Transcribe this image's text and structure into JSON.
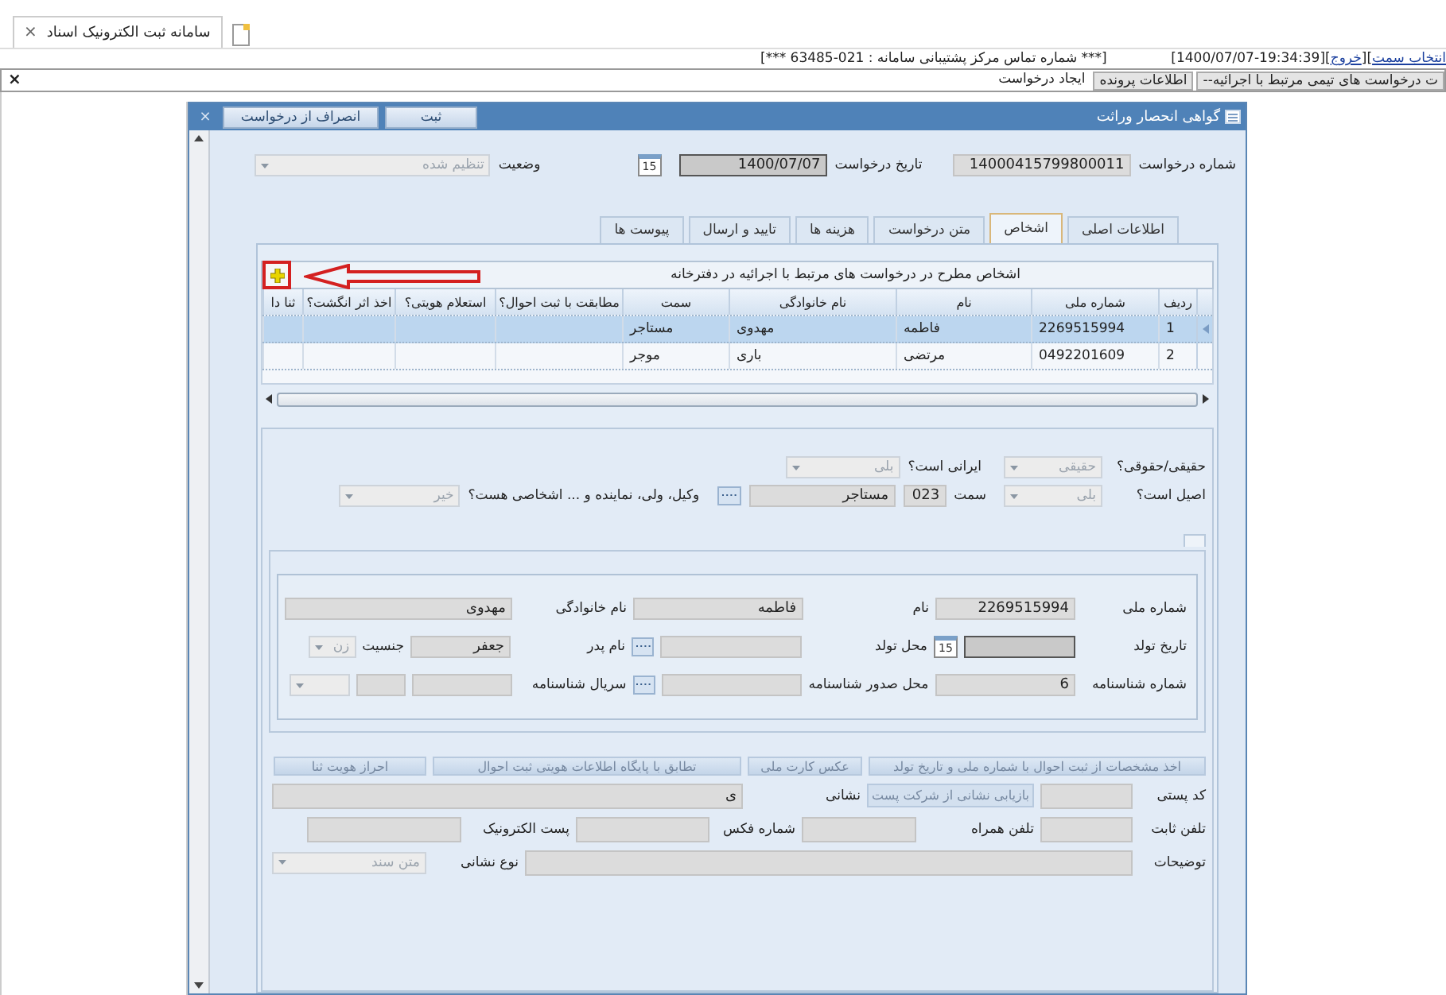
{
  "browser_tab": {
    "title": "سامانه ثبت الکترونیک اسناد",
    "close": "×"
  },
  "session_line": {
    "support": "[*** شماره تماس مرکز پشتیبانی سامانه : 021-63485 ***]",
    "parts": [
      {
        "kind": "link",
        "text": "انتخاب سمت"
      },
      {
        "kind": "text",
        "text": "]["
      },
      {
        "kind": "link",
        "text": "خروج"
      },
      {
        "kind": "text",
        "text": "[1400/07/07-19:34:39]["
      }
    ]
  },
  "menu_bar": {
    "close": "×",
    "items": [
      {
        "label": "ت درخواست های تیمی مرتبط با اجرائیه--",
        "selected": false
      },
      {
        "label": "اطلاعات پرونده",
        "selected": false
      },
      {
        "label": "ایجاد درخواست",
        "selected": true
      }
    ]
  },
  "dialog": {
    "title": "گواهی انحصار وراثت",
    "close": "×",
    "buttons": [
      "ثبت",
      "انصراف از درخواست"
    ],
    "request_number": {
      "label": "شماره درخواست",
      "value": "14000415799800011"
    },
    "request_date": {
      "label": "تاریخ درخواست",
      "value": "1400/07/07",
      "calendar": "15"
    },
    "status": {
      "label": "وضعیت",
      "value": "تنظیم شده"
    },
    "tabs": [
      {
        "label": "اطلاعات اصلی",
        "selected": false
      },
      {
        "label": "اشخاص",
        "selected": true
      },
      {
        "label": "متن درخواست",
        "selected": false
      },
      {
        "label": "هزینه ها",
        "selected": false
      },
      {
        "label": "تایید و ارسال",
        "selected": false
      },
      {
        "label": "پیوست ها",
        "selected": false
      }
    ],
    "persons": {
      "caption": "اشخاص مطرح در درخواست های مرتبط با اجرائیه در دفترخانه",
      "columns": [
        "ردیف",
        "شماره ملی",
        "نام",
        "نام خانوادگی",
        "سمت",
        "مطابقت با ثبت احوال؟",
        "استعلام هویتی؟",
        "اخذ اثر انگشت؟",
        "ثنا دا"
      ],
      "rows": [
        {
          "row": "1",
          "national_id": "2269515994",
          "first_name": "فاطمه",
          "last_name": "مهدوی",
          "role": "مستاجر",
          "selected": true
        },
        {
          "row": "2",
          "national_id": "0492201609",
          "first_name": "مرتضی",
          "last_name": "باری",
          "role": "موجر",
          "selected": false
        }
      ]
    },
    "person_form": {
      "top_rows": [
        [
          {
            "kind": "select",
            "label": "حقیقی/حقوقی؟",
            "value": "حقیقی"
          },
          {
            "kind": "select",
            "label": "ایرانی است؟",
            "value": "بلی"
          }
        ],
        [
          {
            "kind": "select",
            "label": "اصیل است؟",
            "value": "بلی"
          },
          {
            "kind": "lookup",
            "label": "سمت",
            "code": "023",
            "value": "مستاجر"
          },
          {
            "kind": "select",
            "label": "وکیل، ولی، نماینده و ... اشخاصی هست؟",
            "value": "خیر"
          }
        ]
      ],
      "identity_rows": [
        [
          {
            "kind": "text",
            "label": "شماره ملی",
            "value": "2269515994"
          },
          {
            "kind": "text",
            "label": "نام",
            "value": "فاطمه"
          },
          {
            "kind": "text",
            "label": "نام خانوادگی",
            "value": "مهدوی"
          }
        ],
        [
          {
            "kind": "date",
            "label": "تاریخ تولد",
            "calendar": "15"
          },
          {
            "kind": "lookup",
            "label": "محل تولد"
          },
          {
            "kind": "parent",
            "label": "نام پدر",
            "value": "جعفر",
            "gender_label": "جنسیت",
            "gender": "زن"
          }
        ],
        [
          {
            "kind": "text",
            "label": "شماره شناسنامه",
            "value": "6"
          },
          {
            "kind": "lookup",
            "label": "محل صدور شناسنامه"
          },
          {
            "kind": "serial",
            "label": "سریال شناسنامه"
          }
        ]
      ],
      "actions": [
        "اخذ مشخصات از ثبت احوال با شماره ملی و تاریخ تولد",
        "عکس کارت ملی",
        "تطابق با پایگاه اطلاعات هویتی ثبت احوال",
        "احراز هویت ثنا"
      ],
      "contact_rows": [
        [
          {
            "kind": "text",
            "label": "کد پستی"
          },
          {
            "kind": "button",
            "label": "بازیابی نشانی از شرکت پست"
          },
          {
            "kind": "wide",
            "label": "نشانی",
            "value": "ی"
          }
        ],
        [
          {
            "kind": "text",
            "label": "تلفن ثابت"
          },
          {
            "kind": "text",
            "label": "تلفن همراه"
          },
          {
            "kind": "text",
            "label": "شماره فکس"
          },
          {
            "kind": "text",
            "label": "پست الکترونیک"
          }
        ],
        [
          {
            "kind": "notes",
            "label": "توضیحات"
          },
          {
            "kind": "select",
            "label": "نوع نشانی",
            "value": "متن سند"
          }
        ]
      ]
    }
  }
}
